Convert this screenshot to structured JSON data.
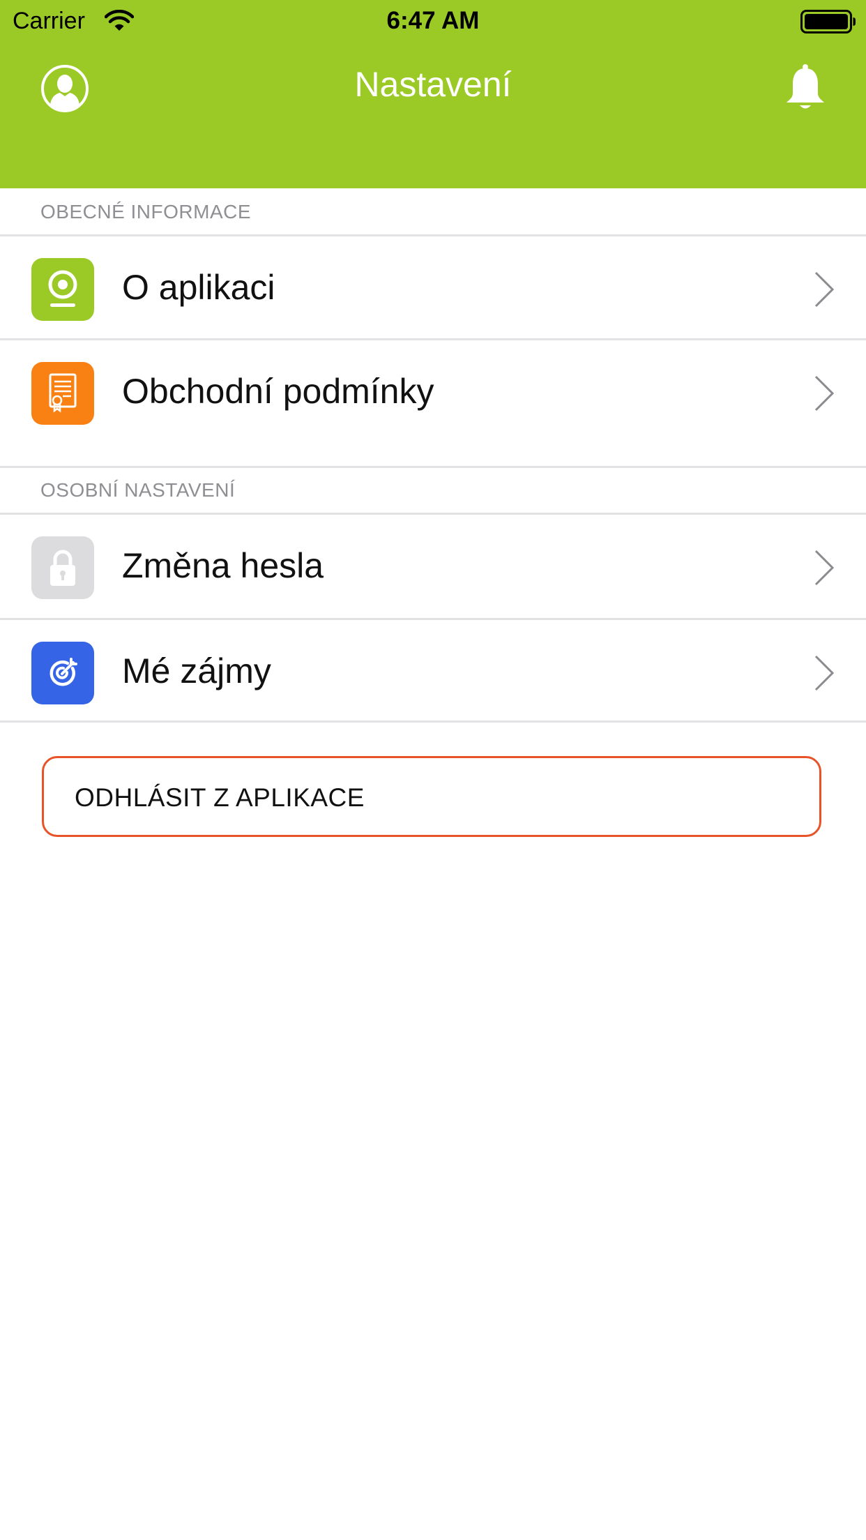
{
  "status_bar": {
    "carrier": "Carrier",
    "time": "6:47 AM",
    "icons": [
      "wifi-icon",
      "battery-icon"
    ]
  },
  "nav": {
    "title": "Nastavení",
    "left_icon": "profile-icon",
    "right_icon": "bell-icon"
  },
  "colors": {
    "header_green": "#9bc925",
    "icon_green": "#9bc925",
    "icon_orange": "#f98012",
    "icon_gray": "#dcdcde",
    "icon_blue": "#3564e6",
    "logout_border": "#e8532a"
  },
  "sections": [
    {
      "title": "OBECNÉ INFORMACE",
      "items": [
        {
          "label": "O aplikaci",
          "icon": "webcam-icon"
        },
        {
          "label": "Obchodní podmínky",
          "icon": "certificate-icon"
        }
      ]
    },
    {
      "title": "OSOBNÍ NASTAVENÍ",
      "items": [
        {
          "label": "Změna hesla",
          "icon": "lock-icon"
        },
        {
          "label": "Mé zájmy",
          "icon": "target-icon"
        }
      ]
    }
  ],
  "logout": {
    "label": "ODHLÁSIT Z APLIKACE"
  }
}
